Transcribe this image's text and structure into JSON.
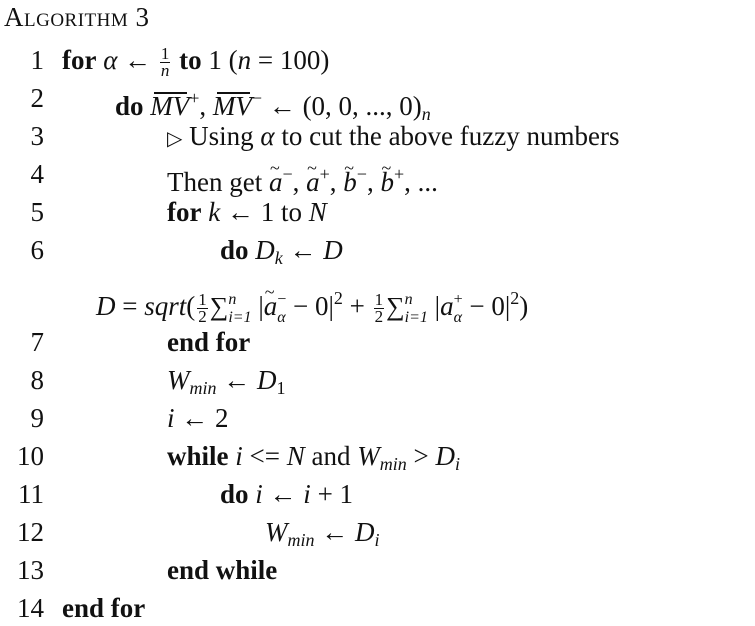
{
  "title": "Algorithm 3",
  "lines": [
    {
      "num": "1",
      "kw1": "for",
      "alpha": "α",
      "arrow": "←",
      "frac_num": "1",
      "frac_den": "n",
      "kw2": "to",
      "rest": "1 (",
      "n": "n",
      "eq": " = 100)"
    },
    {
      "num": "2",
      "kw": "do",
      "mv1": "MV",
      "sup1": "+",
      "sep": ", ",
      "mv2": "MV",
      "sup2": "−",
      "rest": " ← (0, 0, ..., 0)",
      "sub": "n"
    },
    {
      "num": "3",
      "tri": "▷",
      "text1": " Using ",
      "alpha": "α",
      "text2": " to cut the above fuzzy numbers"
    },
    {
      "num": "4",
      "text": "Then get ",
      "a": "a",
      "sup_minus": "−",
      "sup_plus": "+",
      "b": "b",
      "comma": ", ",
      "ellipsis": "..."
    },
    {
      "num": "5",
      "kw": "for",
      "k": "k",
      "rest": " ← 1 to ",
      "N": "N"
    },
    {
      "num": "6",
      "kw": "do",
      "D": "D",
      "sub": "k",
      "rest": " ← ",
      "D2": "D"
    },
    {
      "num": "",
      "formula": {
        "lhs": "D",
        "eq": " = ",
        "fn": "sqrt",
        "paren": "(",
        "half_n": "1",
        "half_d": "2",
        "sum": "∑",
        "sum_top": "n",
        "sum_bot": "i=1",
        "abs1": " |",
        "a": "a",
        "sup_minus": "−",
        "sub_alpha": "α",
        "minus0": " − 0|",
        "sq": "2",
        "plus": " + ",
        "sup_plus": "+",
        "close": ")"
      }
    },
    {
      "num": "7",
      "kw": "end for"
    },
    {
      "num": "8",
      "W": "W",
      "sub": "min",
      "rest": " ← ",
      "D": "D",
      "sub2": "1"
    },
    {
      "num": "9",
      "i": "i",
      "rest": " ← 2"
    },
    {
      "num": "10",
      "kw": "while",
      "i": "i",
      "le": " <= ",
      "N": "N",
      "and": " and ",
      "W": "W",
      "sub": "min",
      "gt": " > ",
      "D": "D",
      "sub2": "i"
    },
    {
      "num": "11",
      "kw": "do",
      "i": "i",
      "rest": " ← ",
      "i2": "i",
      "plus": " + 1"
    },
    {
      "num": "12",
      "W": "W",
      "sub": "min",
      "rest": " ← ",
      "D": "D",
      "sub2": "i"
    },
    {
      "num": "13",
      "kw": "end while"
    },
    {
      "num": "14",
      "kw": "end for"
    }
  ]
}
